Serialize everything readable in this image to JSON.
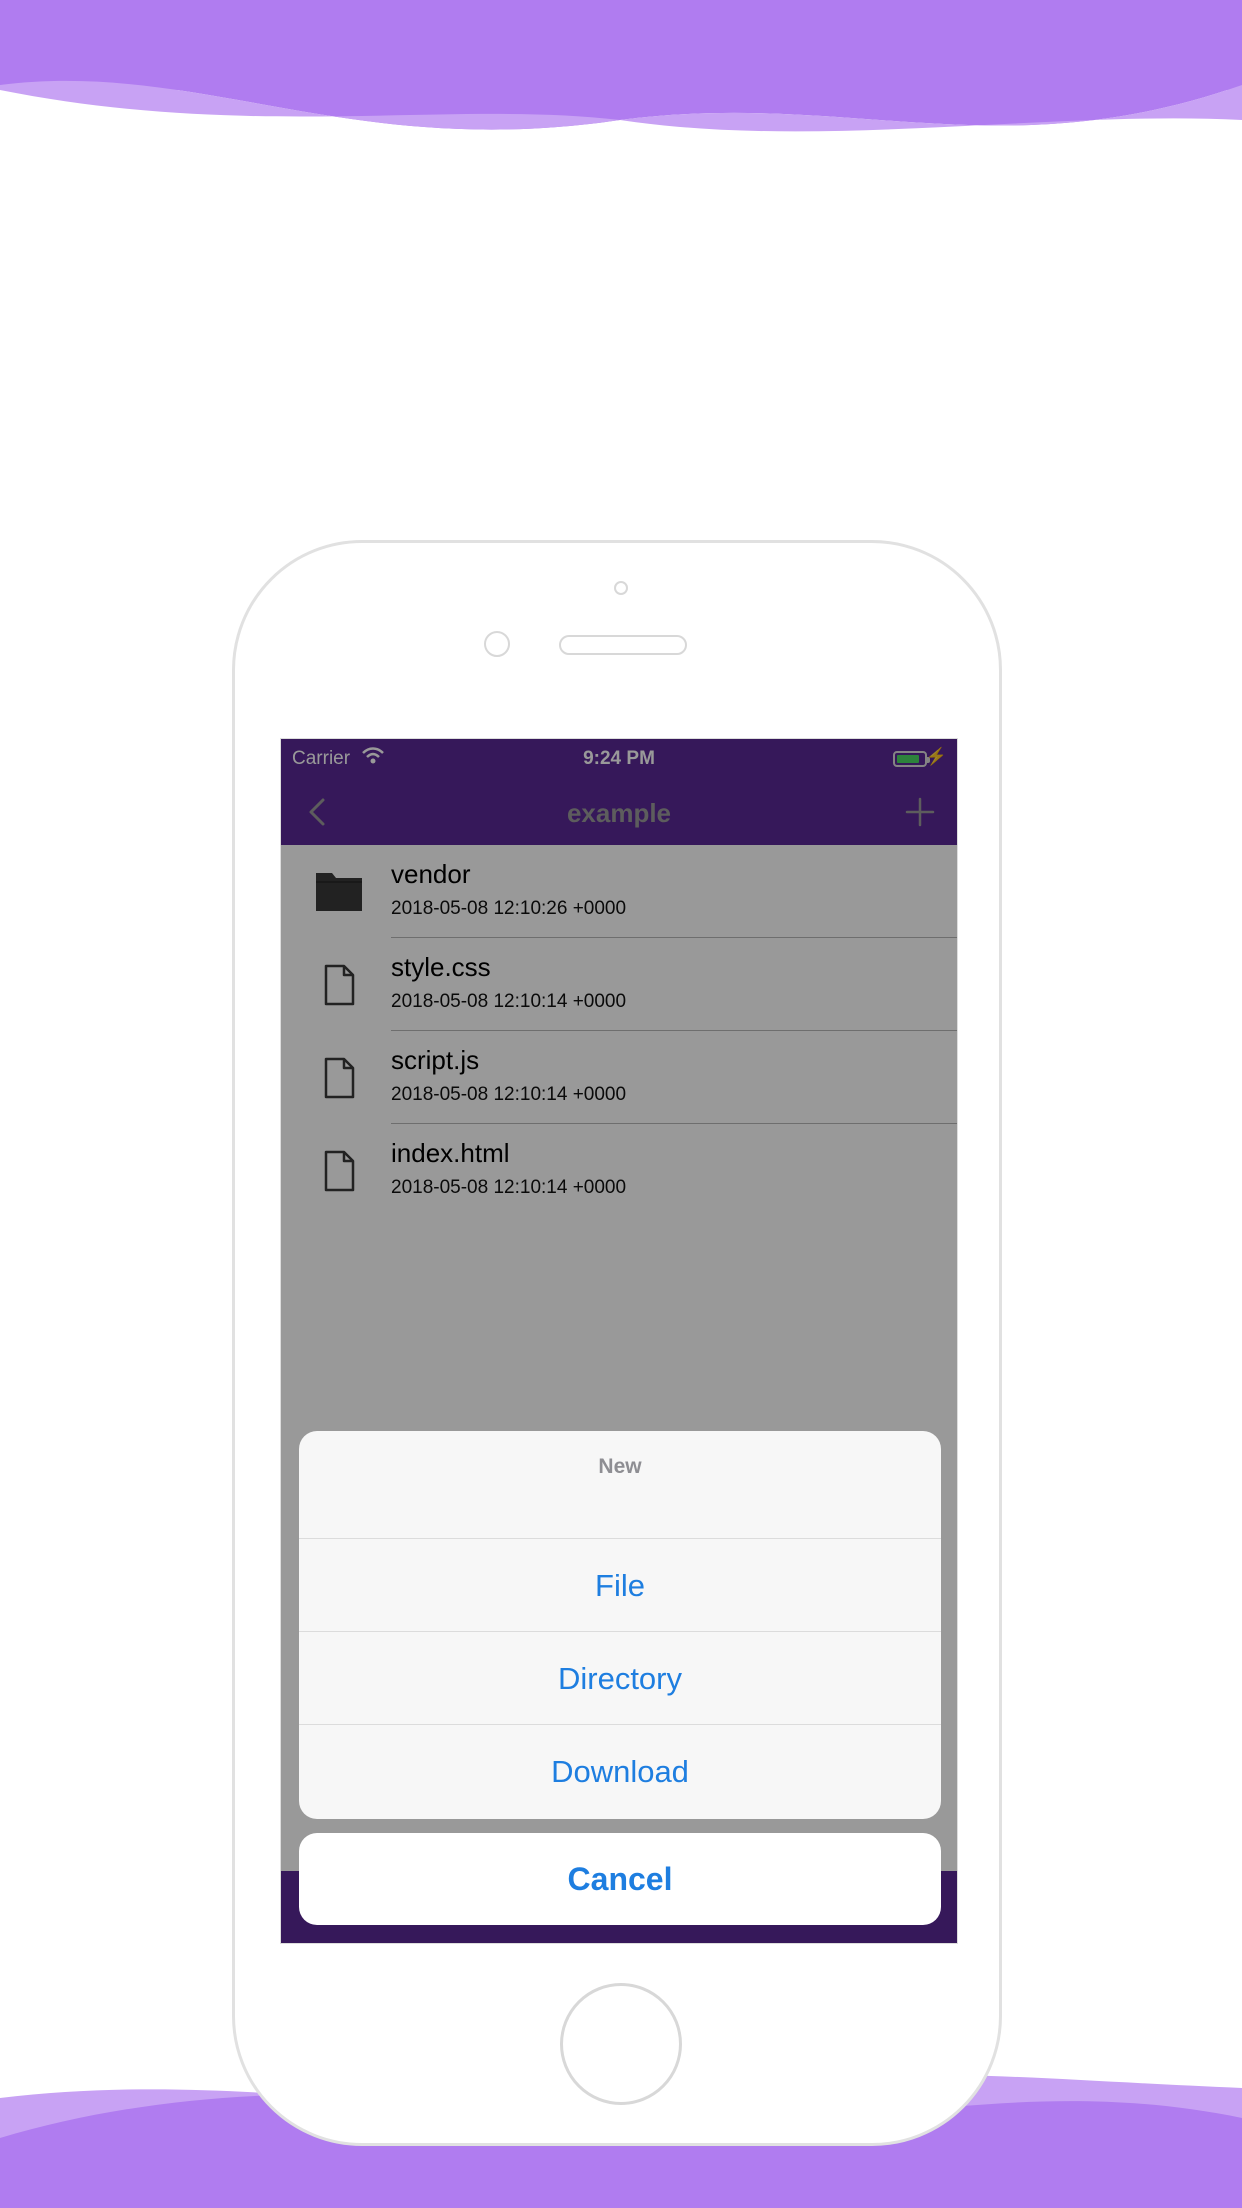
{
  "status_bar": {
    "carrier": "Carrier",
    "time": "9:24 PM"
  },
  "nav": {
    "title": "example",
    "back_icon": "chevron-left-icon",
    "add_icon": "plus-icon"
  },
  "files": [
    {
      "name": "vendor",
      "date": "2018-05-08 12:10:26 +0000",
      "icon": "folder-icon"
    },
    {
      "name": "style.css",
      "date": "2018-05-08 12:10:14 +0000",
      "icon": "file-icon"
    },
    {
      "name": "script.js",
      "date": "2018-05-08 12:10:14 +0000",
      "icon": "file-icon"
    },
    {
      "name": "index.html",
      "date": "2018-05-08 12:10:14 +0000",
      "icon": "file-icon"
    }
  ],
  "action_sheet": {
    "title": "New",
    "items": [
      "File",
      "Directory",
      "Download"
    ],
    "cancel": "Cancel"
  },
  "colors": {
    "brand": "#5a2896",
    "accent": "#1e7ee0",
    "background_wave": "#b07cf0"
  }
}
